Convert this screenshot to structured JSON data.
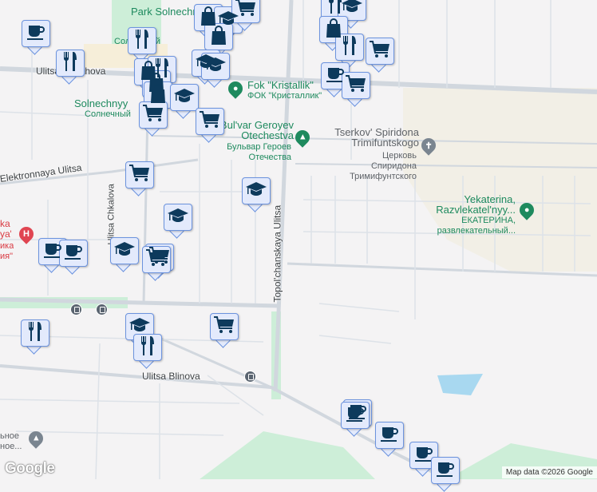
{
  "map": {
    "labels": {
      "park_solnechnyy": "Park Solnechnyy",
      "park_solnechnyy_ru": "Солнечный",
      "ulitsa_chekhova": "Ulitsa Chekhova",
      "fok_kristallik": "Fok \"Kristallik\"",
      "fok_kristallik_ru": "ФОК \"Кристаллик\"",
      "solnechnyy": "Solnechnyy",
      "solnechnyy_ru": "Солнечный",
      "bulvar": "Bul'var Geroyev Otechestva",
      "bulvar_ru": "Бульвар Героев Отечества",
      "tserkov": "Tserkov' Spiridona Trimifuntskogo",
      "tserkov_ru": "Церковь Спиридона Тримифунтского",
      "yekaterina": "Yekaterina, Razvlekatel'nyy...",
      "yekaterina_ru": "ЕКАТЕРИНА, развлекательный...",
      "elektronnaya": "Elektronnaya Ulitsa",
      "ulitsa_chkalova": "Ulitsa Chkalova",
      "topolchanskaya": "Topol'chanskaya Ulitsa",
      "ulitsa_blinova": "Ulitsa Blinova",
      "hospital": "ka ya\"",
      "hospital_ru": "ика ия\"",
      "school_ru": "ьное ное..."
    },
    "markers": [
      "cup",
      "fork",
      "fork",
      "bag",
      "grad",
      "cart",
      "bag",
      "grad",
      "grad",
      "bag",
      "fork",
      "bag",
      "bag",
      "grad",
      "cart",
      "cart",
      "fork",
      "grad",
      "bag",
      "fork",
      "cart",
      "cup",
      "cart",
      "cart",
      "grad",
      "grad",
      "cup",
      "cup",
      "grad",
      "cart",
      "cart",
      "fork",
      "grad",
      "fork",
      "cart",
      "cup",
      "cup",
      "cup",
      "cup",
      "cup"
    ],
    "icon_color": "#0d3a5c",
    "attribution": "Map data ©2026 Google",
    "logo": "Google"
  }
}
